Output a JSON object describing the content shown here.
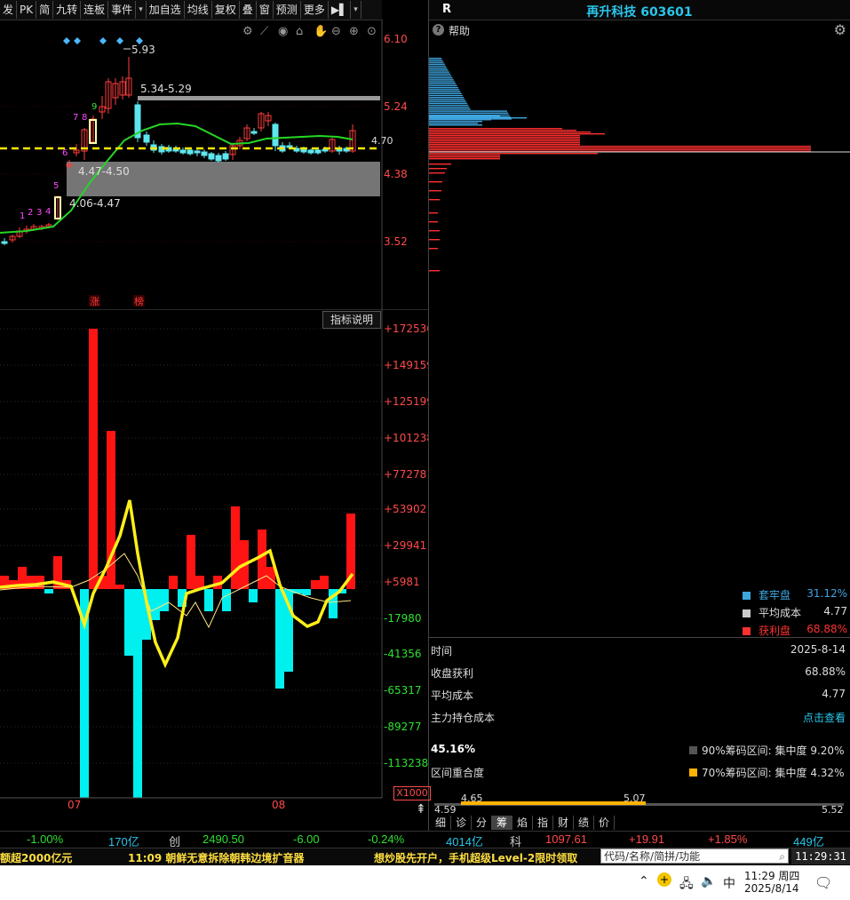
{
  "toolbar": {
    "items": [
      "发",
      "PK",
      "简",
      "九转",
      "连板",
      "事件",
      "▾",
      "加自选",
      "均线",
      "复权",
      "叠",
      "窗",
      "预测",
      "更多",
      "▶▌",
      "▾"
    ]
  },
  "stock": {
    "market_tag": "R",
    "title": "再升科技 603601"
  },
  "help_label": "帮助",
  "kline": {
    "price_axis": [
      "6.10",
      "5.24",
      "4.38",
      "3.52"
    ],
    "annotations": {
      "high": "5.93",
      "resistance": "5.34-5.29",
      "zone1": "4.47-4.50",
      "zone2": "4.06-4.47",
      "last": "4.70"
    },
    "sequence_marks": [
      "1",
      "2",
      "3",
      "4",
      "5",
      "6",
      "7",
      "8",
      "9"
    ],
    "badges": [
      "涨",
      "榜"
    ]
  },
  "indicator": {
    "button": "指标说明",
    "axis": [
      "+172536",
      "+149159",
      "+125199",
      "+101238",
      "+77278",
      "+53902",
      "+29941",
      "+5981",
      "-17980",
      "-41356",
      "-65317",
      "-89277",
      "-113238"
    ],
    "multiplier": "X1000",
    "months": [
      "07",
      "08"
    ]
  },
  "chip": {
    "legend": [
      {
        "label": "套牢盘",
        "value": "31.12%",
        "color": "#3fa6e0"
      },
      {
        "label": "平均成本",
        "value": "4.77",
        "color": "#cccccc"
      },
      {
        "label": "获利盘",
        "value": "68.88%",
        "color": "#ff3030"
      }
    ],
    "info": [
      {
        "label": "时间",
        "value": "2025-8-14"
      },
      {
        "label": "收盘获利",
        "value": "68.88%"
      },
      {
        "label": "平均成本",
        "value": "4.77"
      },
      {
        "label": "主力持仓成本",
        "value": "点击查看"
      }
    ],
    "overlap_pct": "45.16%",
    "overlap_label": "区间重合度",
    "range90": "90%筹码区间: 集中度  9.20%",
    "range70": "70%筹码区间: 集中度  4.32%",
    "bar_labels": {
      "a": "4.65",
      "b": "5.07",
      "c": "4.59",
      "d": "5.52"
    }
  },
  "tabs": [
    "细",
    "诊",
    "分",
    "筹",
    "焰",
    "指",
    "财",
    "绩",
    "价"
  ],
  "ticker": [
    {
      "t": "-1.00%",
      "c": "#2ee02e"
    },
    {
      "t": "170亿",
      "c": "#29c6ea"
    },
    {
      "t": "创",
      "c": "#ccc"
    },
    {
      "t": "2490.50",
      "c": "#2ee02e"
    },
    {
      "t": "-6.00",
      "c": "#2ee02e"
    },
    {
      "t": "-0.24%",
      "c": "#2ee02e"
    },
    {
      "t": "4014亿",
      "c": "#29c6ea"
    },
    {
      "t": "科",
      "c": "#ccc"
    },
    {
      "t": "1097.61",
      "c": "#ff4a4a"
    },
    {
      "t": "+19.91",
      "c": "#ff4a4a"
    },
    {
      "t": "+1.85%",
      "c": "#ff4a4a"
    },
    {
      "t": "449亿",
      "c": "#29c6ea"
    }
  ],
  "news": [
    "额超2000亿元",
    "11:09 朝鲜无意拆除朝韩边境扩音器",
    "想炒股先开户，手机超级Level-2限时领取"
  ],
  "search_placeholder": "代码/名称/简拼/功能",
  "clock": "11:29:31",
  "taskbar": {
    "ime": "中",
    "time": "11:29 周四",
    "date": "2025/8/14"
  }
}
